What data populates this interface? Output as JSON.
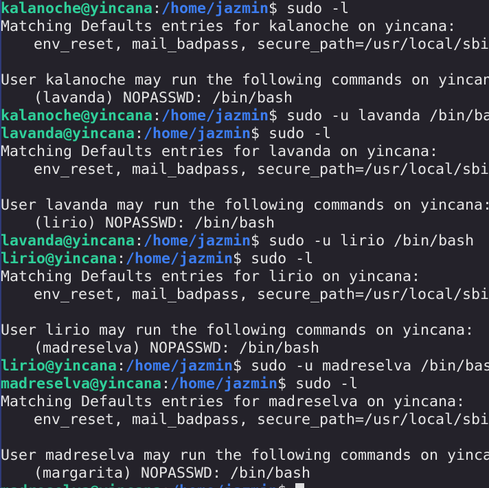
{
  "colors": {
    "background": "#24222a",
    "text": "#e6e6e6",
    "prompt_user": "#2fd09a",
    "prompt_path": "#3d7df0"
  },
  "lines": [
    {
      "type": "prompt",
      "user": "kalanoche@yincana",
      "sep": ":",
      "path": "/home/jazmin",
      "sigil": "$ ",
      "command": "sudo -l"
    },
    {
      "type": "text",
      "text": "Matching Defaults entries for kalanoche on yincana:"
    },
    {
      "type": "indent",
      "text": "env_reset, mail_badpass, secure_path=/usr/local/sbin\\:/usr/local/bin\\:/usr/sbin\\:/usr/bin\\:/sbin\\:/bin"
    },
    {
      "type": "blank"
    },
    {
      "type": "text",
      "text": "User kalanoche may run the following commands on yincana:"
    },
    {
      "type": "indent",
      "text": "(lavanda) NOPASSWD: /bin/bash"
    },
    {
      "type": "prompt",
      "user": "kalanoche@yincana",
      "sep": ":",
      "path": "/home/jazmin",
      "sigil": "$ ",
      "command": "sudo -u lavanda /bin/bash"
    },
    {
      "type": "prompt",
      "user": "lavanda@yincana",
      "sep": ":",
      "path": "/home/jazmin",
      "sigil": "$ ",
      "command": "sudo -l"
    },
    {
      "type": "text",
      "text": "Matching Defaults entries for lavanda on yincana:"
    },
    {
      "type": "indent",
      "text": "env_reset, mail_badpass, secure_path=/usr/local/sbin\\:/usr/local/bin\\:/usr/sbin\\:/usr/bin\\:/sbin\\:/bin"
    },
    {
      "type": "blank"
    },
    {
      "type": "text",
      "text": "User lavanda may run the following commands on yincana:"
    },
    {
      "type": "indent",
      "text": "(lirio) NOPASSWD: /bin/bash"
    },
    {
      "type": "prompt",
      "user": "lavanda@yincana",
      "sep": ":",
      "path": "/home/jazmin",
      "sigil": "$ ",
      "command": "sudo -u lirio /bin/bash"
    },
    {
      "type": "prompt",
      "user": "lirio@yincana",
      "sep": ":",
      "path": "/home/jazmin",
      "sigil": "$ ",
      "command": "sudo -l"
    },
    {
      "type": "text",
      "text": "Matching Defaults entries for lirio on yincana:"
    },
    {
      "type": "indent",
      "text": "env_reset, mail_badpass, secure_path=/usr/local/sbin\\:/usr/local/bin\\:/usr/sbin\\:/usr/bin\\:/sbin\\:/bin"
    },
    {
      "type": "blank"
    },
    {
      "type": "text",
      "text": "User lirio may run the following commands on yincana:"
    },
    {
      "type": "indent",
      "text": "(madreselva) NOPASSWD: /bin/bash"
    },
    {
      "type": "prompt",
      "user": "lirio@yincana",
      "sep": ":",
      "path": "/home/jazmin",
      "sigil": "$ ",
      "command": "sudo -u madreselva /bin/bash"
    },
    {
      "type": "prompt",
      "user": "madreselva@yincana",
      "sep": ":",
      "path": "/home/jazmin",
      "sigil": "$ ",
      "command": "sudo -l"
    },
    {
      "type": "text",
      "text": "Matching Defaults entries for madreselva on yincana:"
    },
    {
      "type": "indent",
      "text": "env_reset, mail_badpass, secure_path=/usr/local/sbin\\:/usr/local/bin\\:/usr/sbin\\:/usr/bin\\:/sbin\\:/bin"
    },
    {
      "type": "blank"
    },
    {
      "type": "text",
      "text": "User madreselva may run the following commands on yincana:"
    },
    {
      "type": "indent",
      "text": "(margarita) NOPASSWD: /bin/bash"
    },
    {
      "type": "prompt-cursor",
      "user": "madreselva@yincana",
      "sep": ":",
      "path": "/home/jazmin",
      "sigil": "$ ",
      "command": ""
    }
  ]
}
